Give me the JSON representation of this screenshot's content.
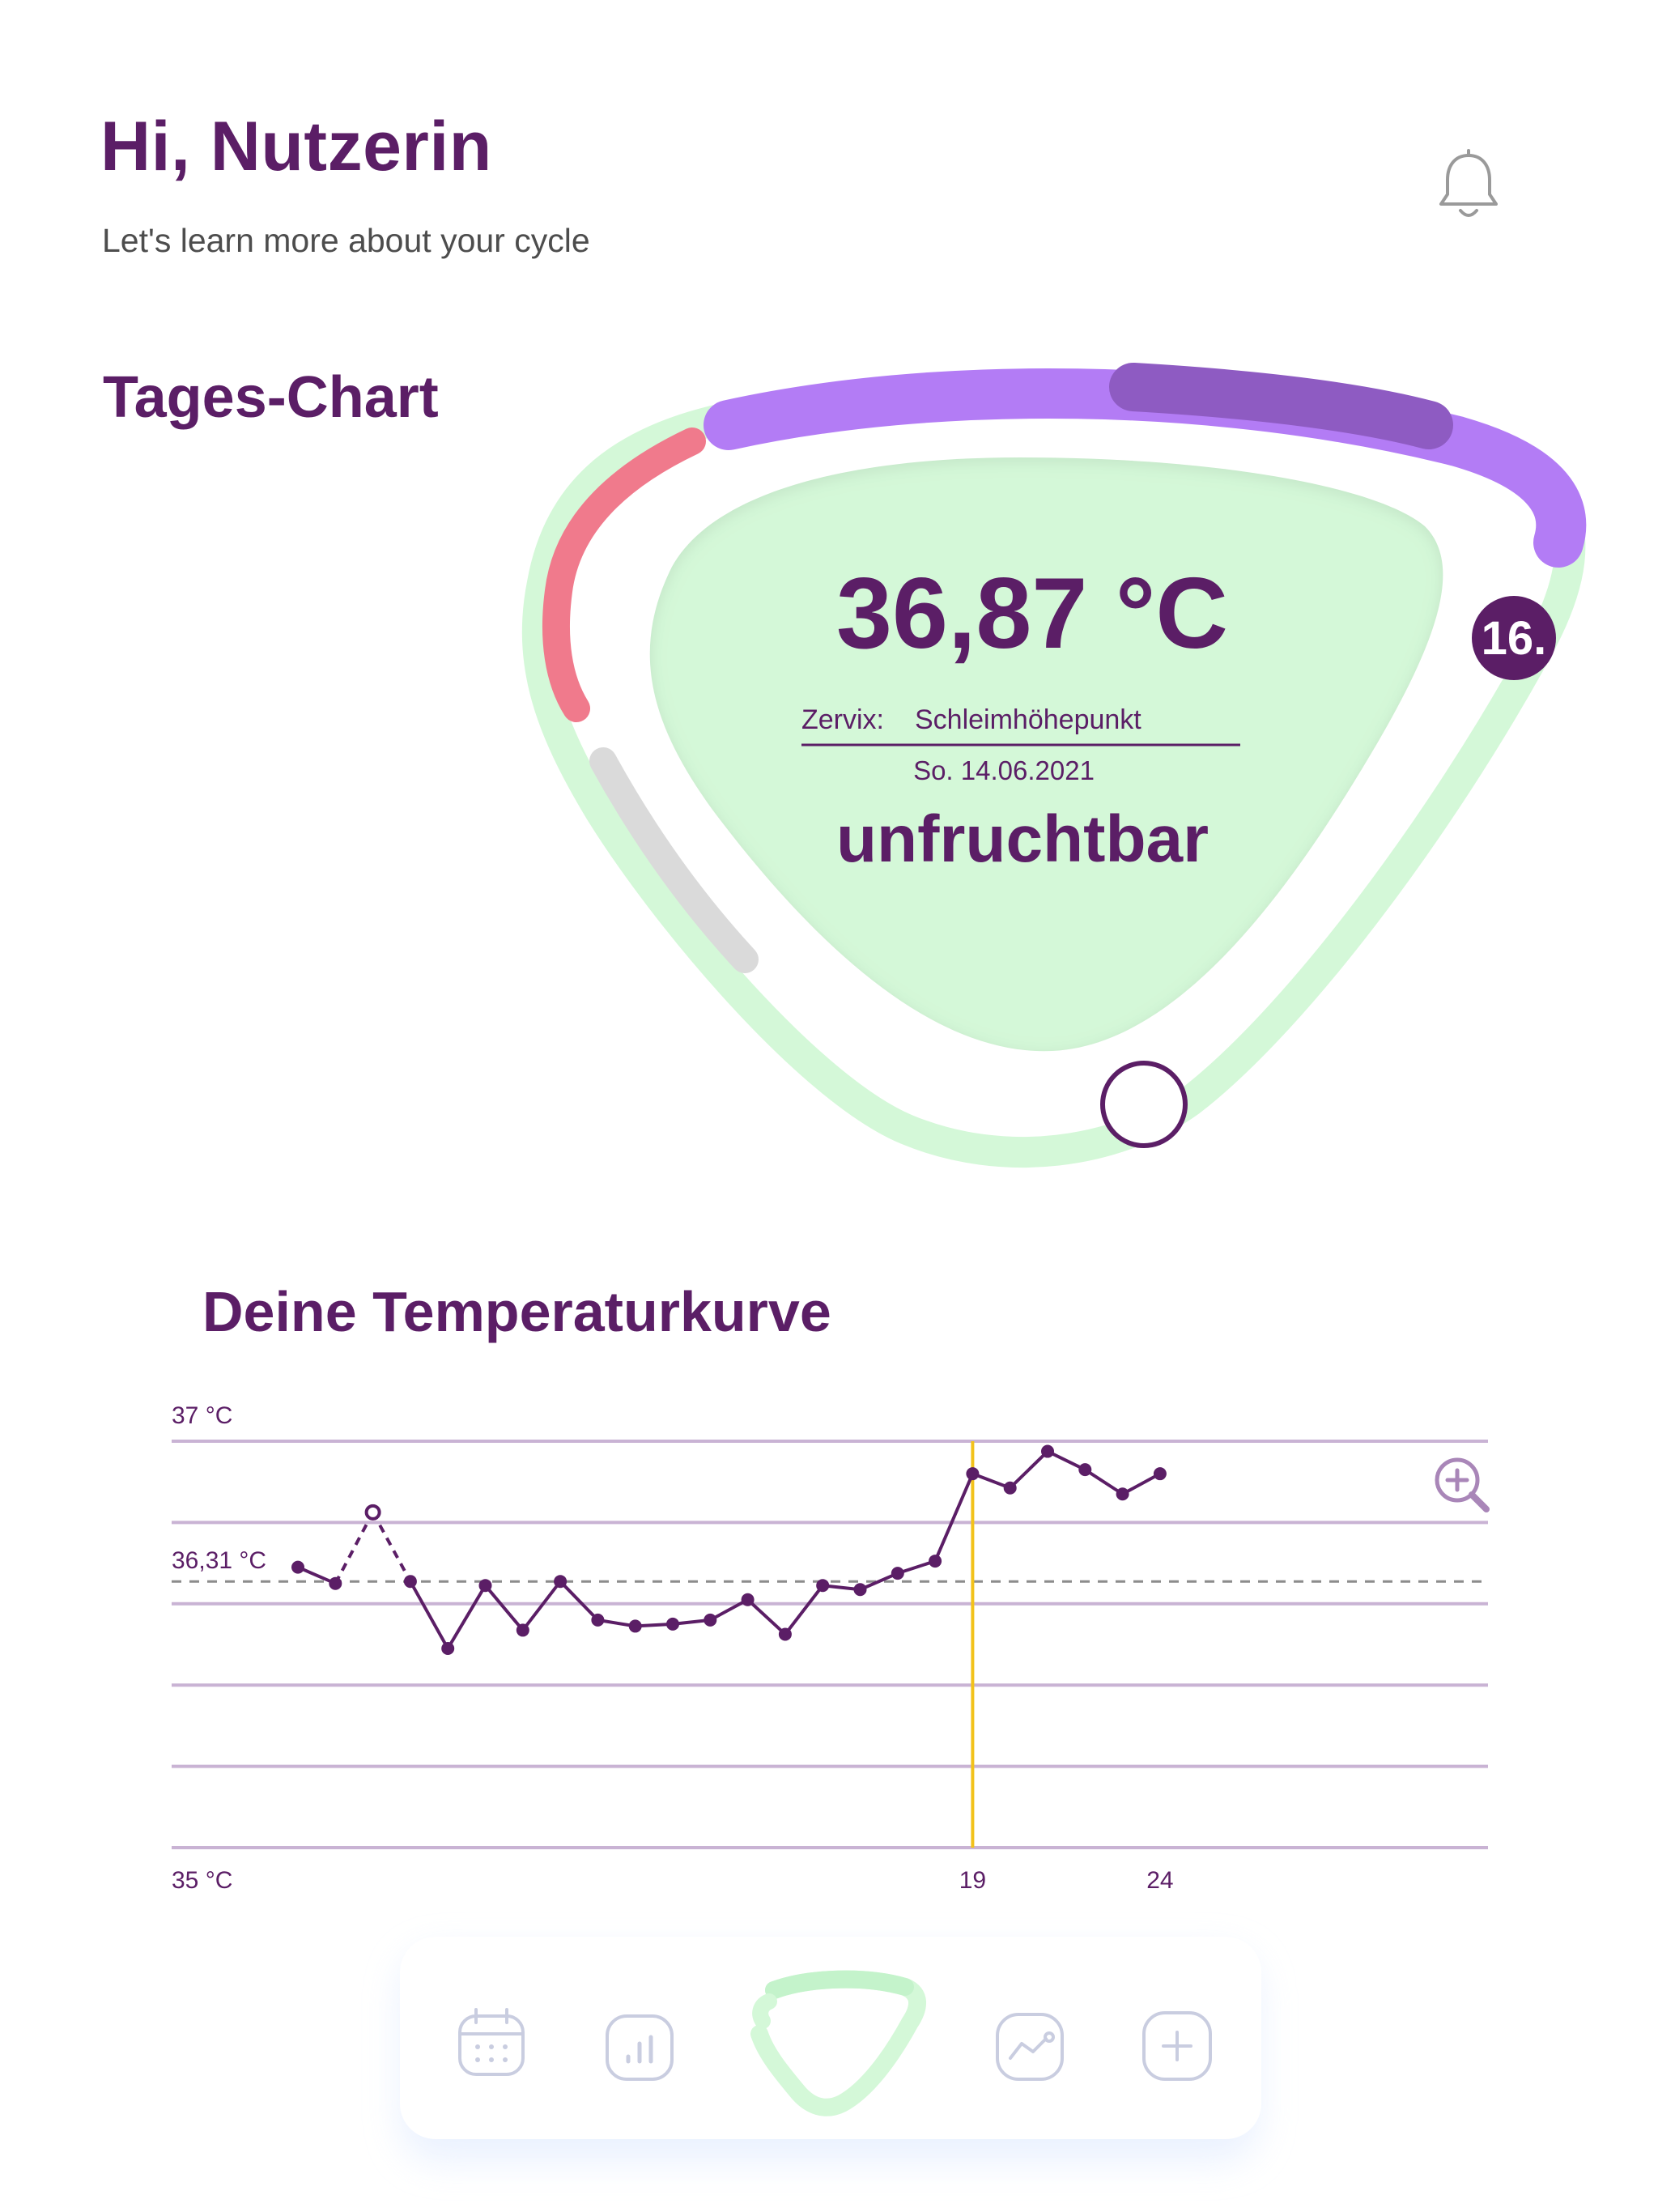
{
  "header": {
    "greeting": "Hi, Nutzerin",
    "subtitle": "Let's learn more about your cycle",
    "notification_icon": "bell-icon"
  },
  "day_chart": {
    "title": "Tages-Chart",
    "temperature": "36,87 °C",
    "cervix_label": "Zervix:",
    "cervix_value": "Schleimhöhepunkt",
    "date": "So. 14.06.2021",
    "status": "unfruchtbar",
    "cycle_day": "16.",
    "colors": {
      "fertile_bg": "#d4f8d8",
      "period": "#f07a8c",
      "phase_light": "#b37cf5",
      "phase_dark": "#8e5bc2",
      "inactive": "#d9d9d9",
      "text": "#5b1e66"
    }
  },
  "temperature_curve": {
    "title": "Deine Temperaturkurve",
    "zoom_icon": "zoom-in-icon"
  },
  "chart_data": {
    "type": "line",
    "title": "Deine Temperaturkurve",
    "ytick_labels": [
      "37 °C",
      "36,31 °C",
      "35 °C"
    ],
    "xtick_labels": [
      "19",
      "24"
    ],
    "y_top_label": "37 °C",
    "y_bottom_label": "35 °C",
    "baseline_label": "36,31 °C",
    "baseline": 36.31,
    "ylim": [
      35,
      37
    ],
    "highlight_x": 19,
    "x": [
      1,
      2,
      3,
      4,
      5,
      6,
      7,
      8,
      9,
      10,
      11,
      12,
      13,
      14,
      15,
      16,
      17,
      18,
      19,
      20,
      21,
      22,
      23,
      24
    ],
    "values": [
      36.38,
      36.3,
      36.65,
      36.31,
      35.98,
      36.29,
      36.07,
      36.31,
      36.12,
      36.09,
      36.1,
      36.12,
      36.22,
      36.05,
      36.29,
      36.27,
      36.35,
      36.41,
      36.84,
      36.77,
      36.95,
      36.86,
      36.74,
      36.84
    ],
    "excluded_points": [
      3
    ],
    "grid": true
  },
  "bottom_nav": {
    "items": [
      {
        "icon": "calendar-icon"
      },
      {
        "icon": "bar-chart-icon"
      },
      {
        "icon": "cycle-icon",
        "active": true
      },
      {
        "icon": "trend-chart-icon"
      },
      {
        "icon": "plus-icon"
      }
    ]
  }
}
